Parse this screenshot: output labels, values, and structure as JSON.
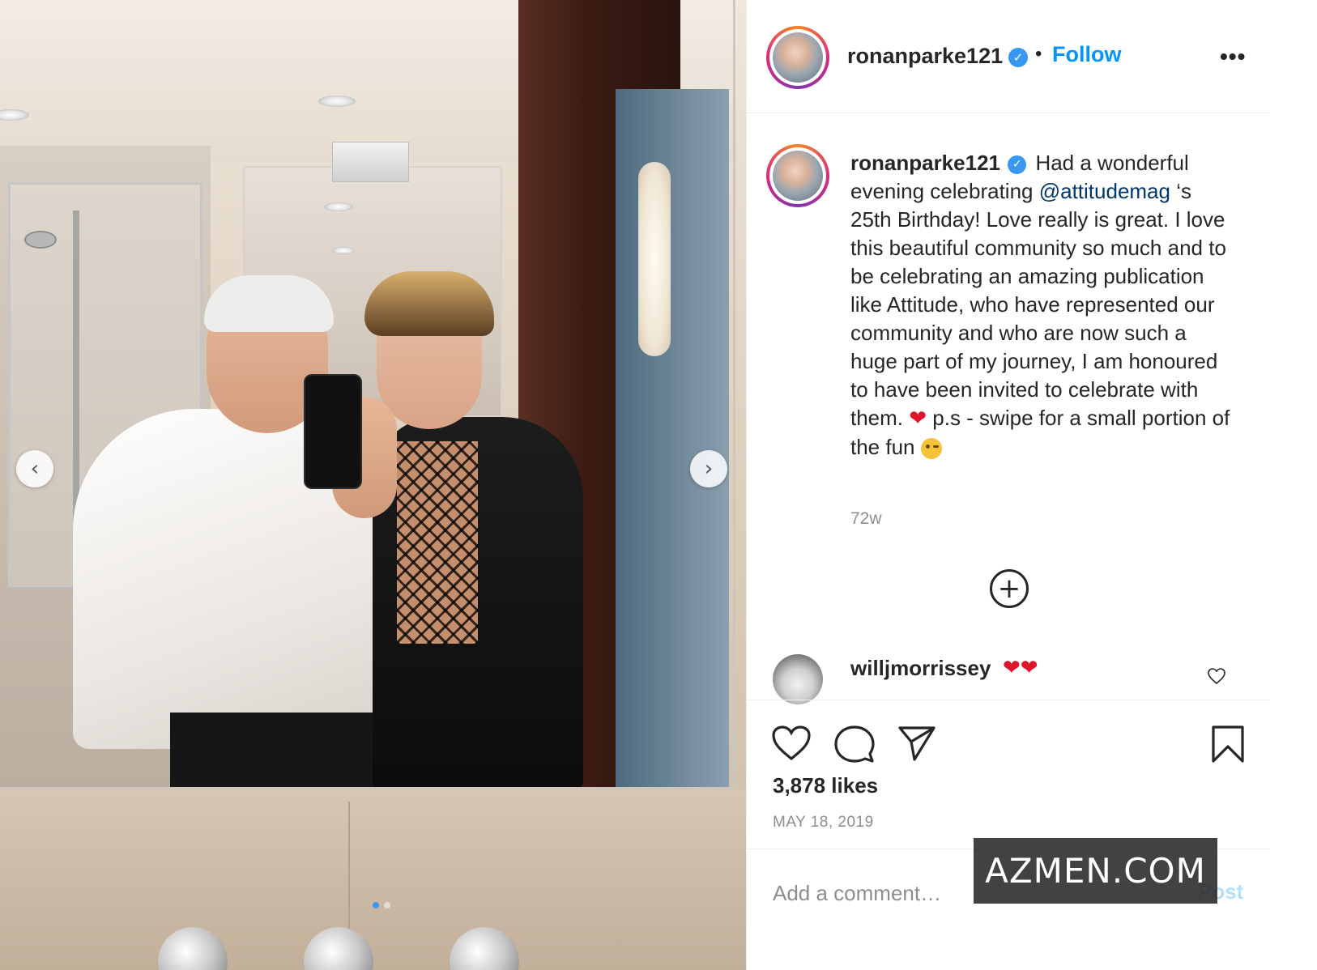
{
  "post": {
    "author": "ronanparke121",
    "follow_label": "Follow",
    "bullet": "•",
    "more_label": "•••",
    "caption": {
      "line1_text": " Had a wonderful evening celebrating ",
      "mention": "@attitudemag",
      "line2_text": " ‘s 25th Birthday! Love really is great. I love this beautiful community so much and to be celebrating an amazing publication like Attitude, who have represented our community and who are now such a huge part of my journey, I am honoured to have been invited to celebrate with them. ",
      "heart": "❤",
      "line3_text": " p.s - swipe for a small portion of the fun "
    },
    "time_ago": "72w",
    "load_more_symbol": "+",
    "comments": [
      {
        "user": "willjmorrissey",
        "text": "❤❤"
      }
    ],
    "likes": "3,878 likes",
    "date": "MAY 18, 2019",
    "comment_placeholder": "Add a comment…",
    "post_label": "Post"
  },
  "carousel": {
    "prev_symbol": "‹",
    "next_symbol": "›",
    "slides": 2,
    "active_slide": 1
  },
  "watermark": "AZMEN.COM",
  "colors": {
    "accent": "#0095f6",
    "verified": "#3897f0",
    "heart": "#e0142a",
    "mention": "#00376b",
    "muted": "#8e8e8e"
  },
  "icons": {
    "like": "heart-icon",
    "comment": "comment-bubble-icon",
    "share": "paper-plane-icon",
    "save": "bookmark-icon",
    "more": "more-options-icon",
    "load_more": "plus-circle-icon",
    "verified": "verified-badge-icon"
  }
}
